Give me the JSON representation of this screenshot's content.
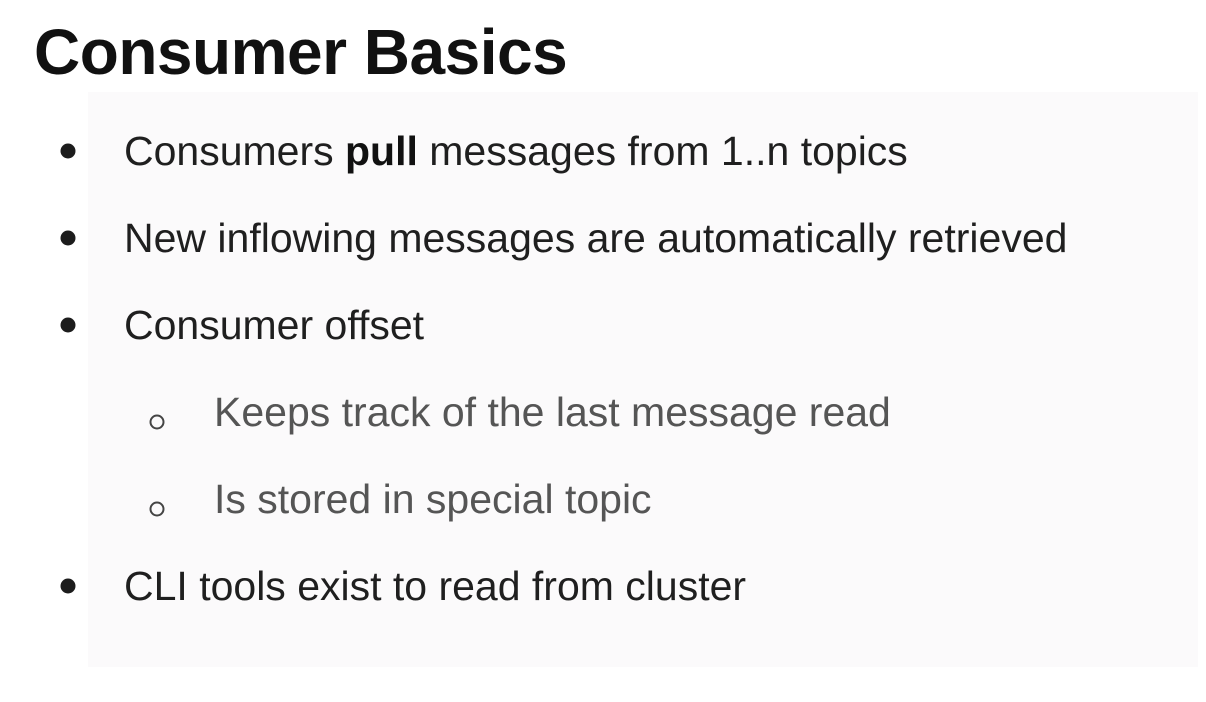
{
  "slide": {
    "title": "Consumer Basics",
    "bullets": [
      {
        "level": 1,
        "text_before": "Consumers ",
        "text_bold": "pull",
        "text_after": " messages from 1..n topics"
      },
      {
        "level": 1,
        "text": "New inflowing messages are automatically retrieved"
      },
      {
        "level": 1,
        "text": "Consumer offset"
      },
      {
        "level": 2,
        "text": "Keeps track of the last message read"
      },
      {
        "level": 2,
        "text": "Is stored in special topic"
      },
      {
        "level": 1,
        "text": "CLI tools exist to read from cluster"
      }
    ]
  }
}
